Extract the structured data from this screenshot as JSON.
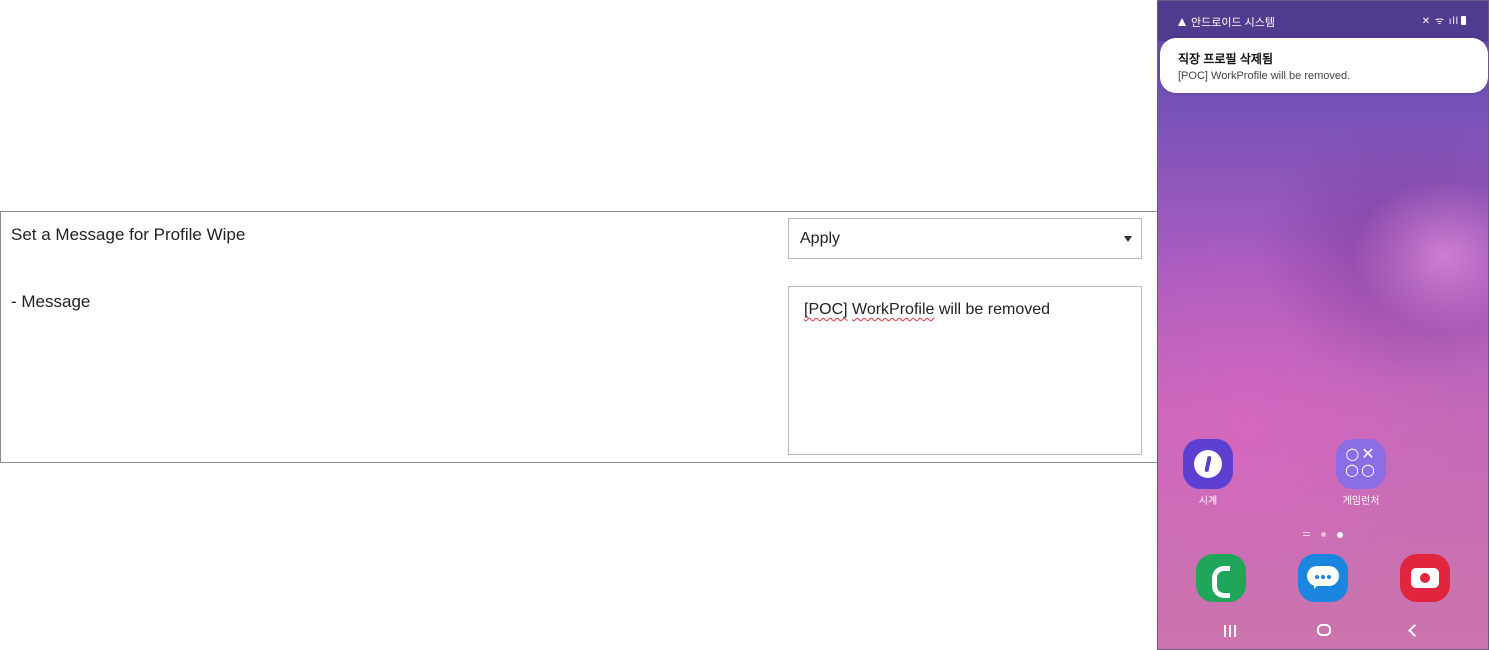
{
  "settings": {
    "wipe_label": "Set a Message for Profile Wipe",
    "wipe_select_value": "Apply",
    "message_label": "- Message",
    "message_value_parts": [
      "[POC]",
      " ",
      "WorkProfile",
      " will be removed"
    ]
  },
  "phone": {
    "statusbar": {
      "source": "안드로이드 시스템",
      "icons_text": "✕ ᯤ ıll"
    },
    "notification": {
      "title": "직장 프로필 삭제됨",
      "body": "[POC] WorkProfile will be removed."
    },
    "apps": [
      {
        "label": "시계",
        "icon": "clock-icon"
      },
      {
        "label": "게임런처",
        "icon": "game-launcher-icon"
      }
    ],
    "game_launcher_glyph": "○✕\n○○",
    "dock": [
      {
        "icon": "phone-icon"
      },
      {
        "icon": "messages-icon"
      },
      {
        "icon": "camera-icon"
      }
    ],
    "page_indicator": {
      "pages": 2,
      "current": 2
    },
    "colors": {
      "statusbar": "#4f3c8e",
      "phone_app": "#1fa65a",
      "messages_app": "#1a86e0",
      "camera_app": "#e0253d",
      "clock_app": "#5b3fd1",
      "game_launcher_app": "#8b6ee6"
    }
  }
}
